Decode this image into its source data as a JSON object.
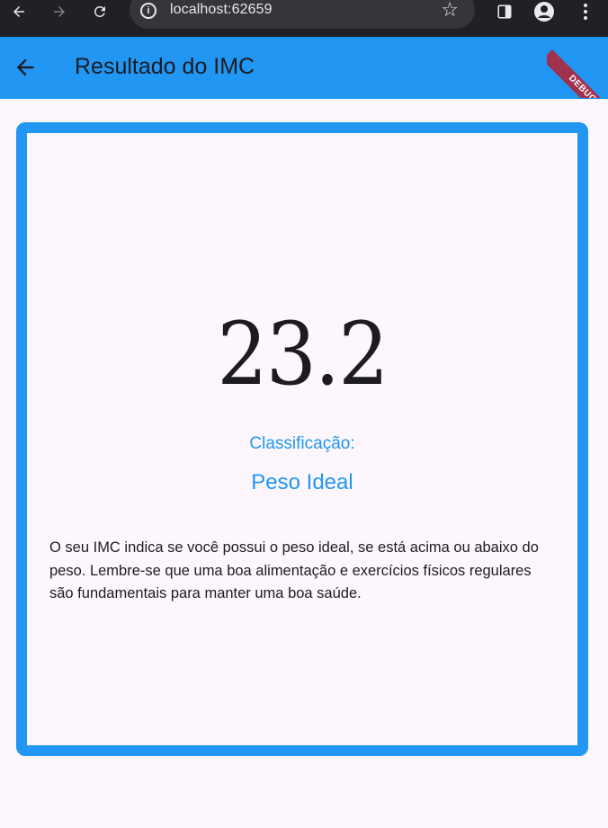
{
  "browser": {
    "url": "localhost:62659",
    "icons": [
      "back-arrow-icon",
      "forward-arrow-icon",
      "reload-icon",
      "info-icon",
      "star-icon",
      "side-panel-icon",
      "profile-icon",
      "kebab-menu-icon"
    ]
  },
  "appbar": {
    "title": "Resultado do IMC",
    "color": "#2196f3",
    "debug_label": "DEBUG"
  },
  "result": {
    "imc": "23.2",
    "classification_label": "Classificação:",
    "classification": "Peso Ideal",
    "description": "O seu IMC indica se você possui o peso ideal, se está acima ou abaixo do peso. Lembre-se que uma boa alimentação e exercícios físicos regulares são fundamentais para manter uma boa saúde."
  }
}
